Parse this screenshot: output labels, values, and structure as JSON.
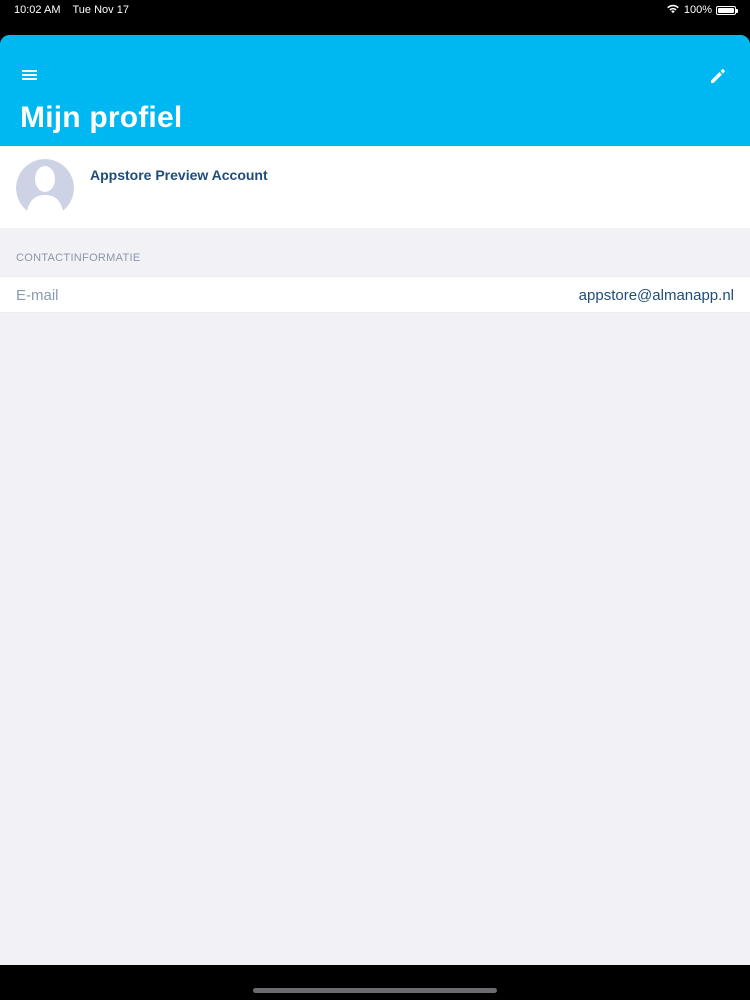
{
  "status_bar": {
    "time": "10:02 AM",
    "date": "Tue Nov 17",
    "battery_percent": "100%",
    "battery_level": 1.0,
    "wifi_icon": "wifi-icon",
    "battery_icon": "battery-icon"
  },
  "header": {
    "title": "Mijn profiel",
    "menu_icon": "hamburger-menu-icon",
    "edit_icon": "pencil-icon",
    "background_color": "#00b8f1"
  },
  "profile": {
    "name": "Appstore Preview Account",
    "avatar_icon": "avatar-placeholder-icon"
  },
  "contact": {
    "section_title": "CONTACTINFORMATIE",
    "rows": [
      {
        "label": "E-mail",
        "value": "appstore@almanapp.nl"
      }
    ]
  }
}
